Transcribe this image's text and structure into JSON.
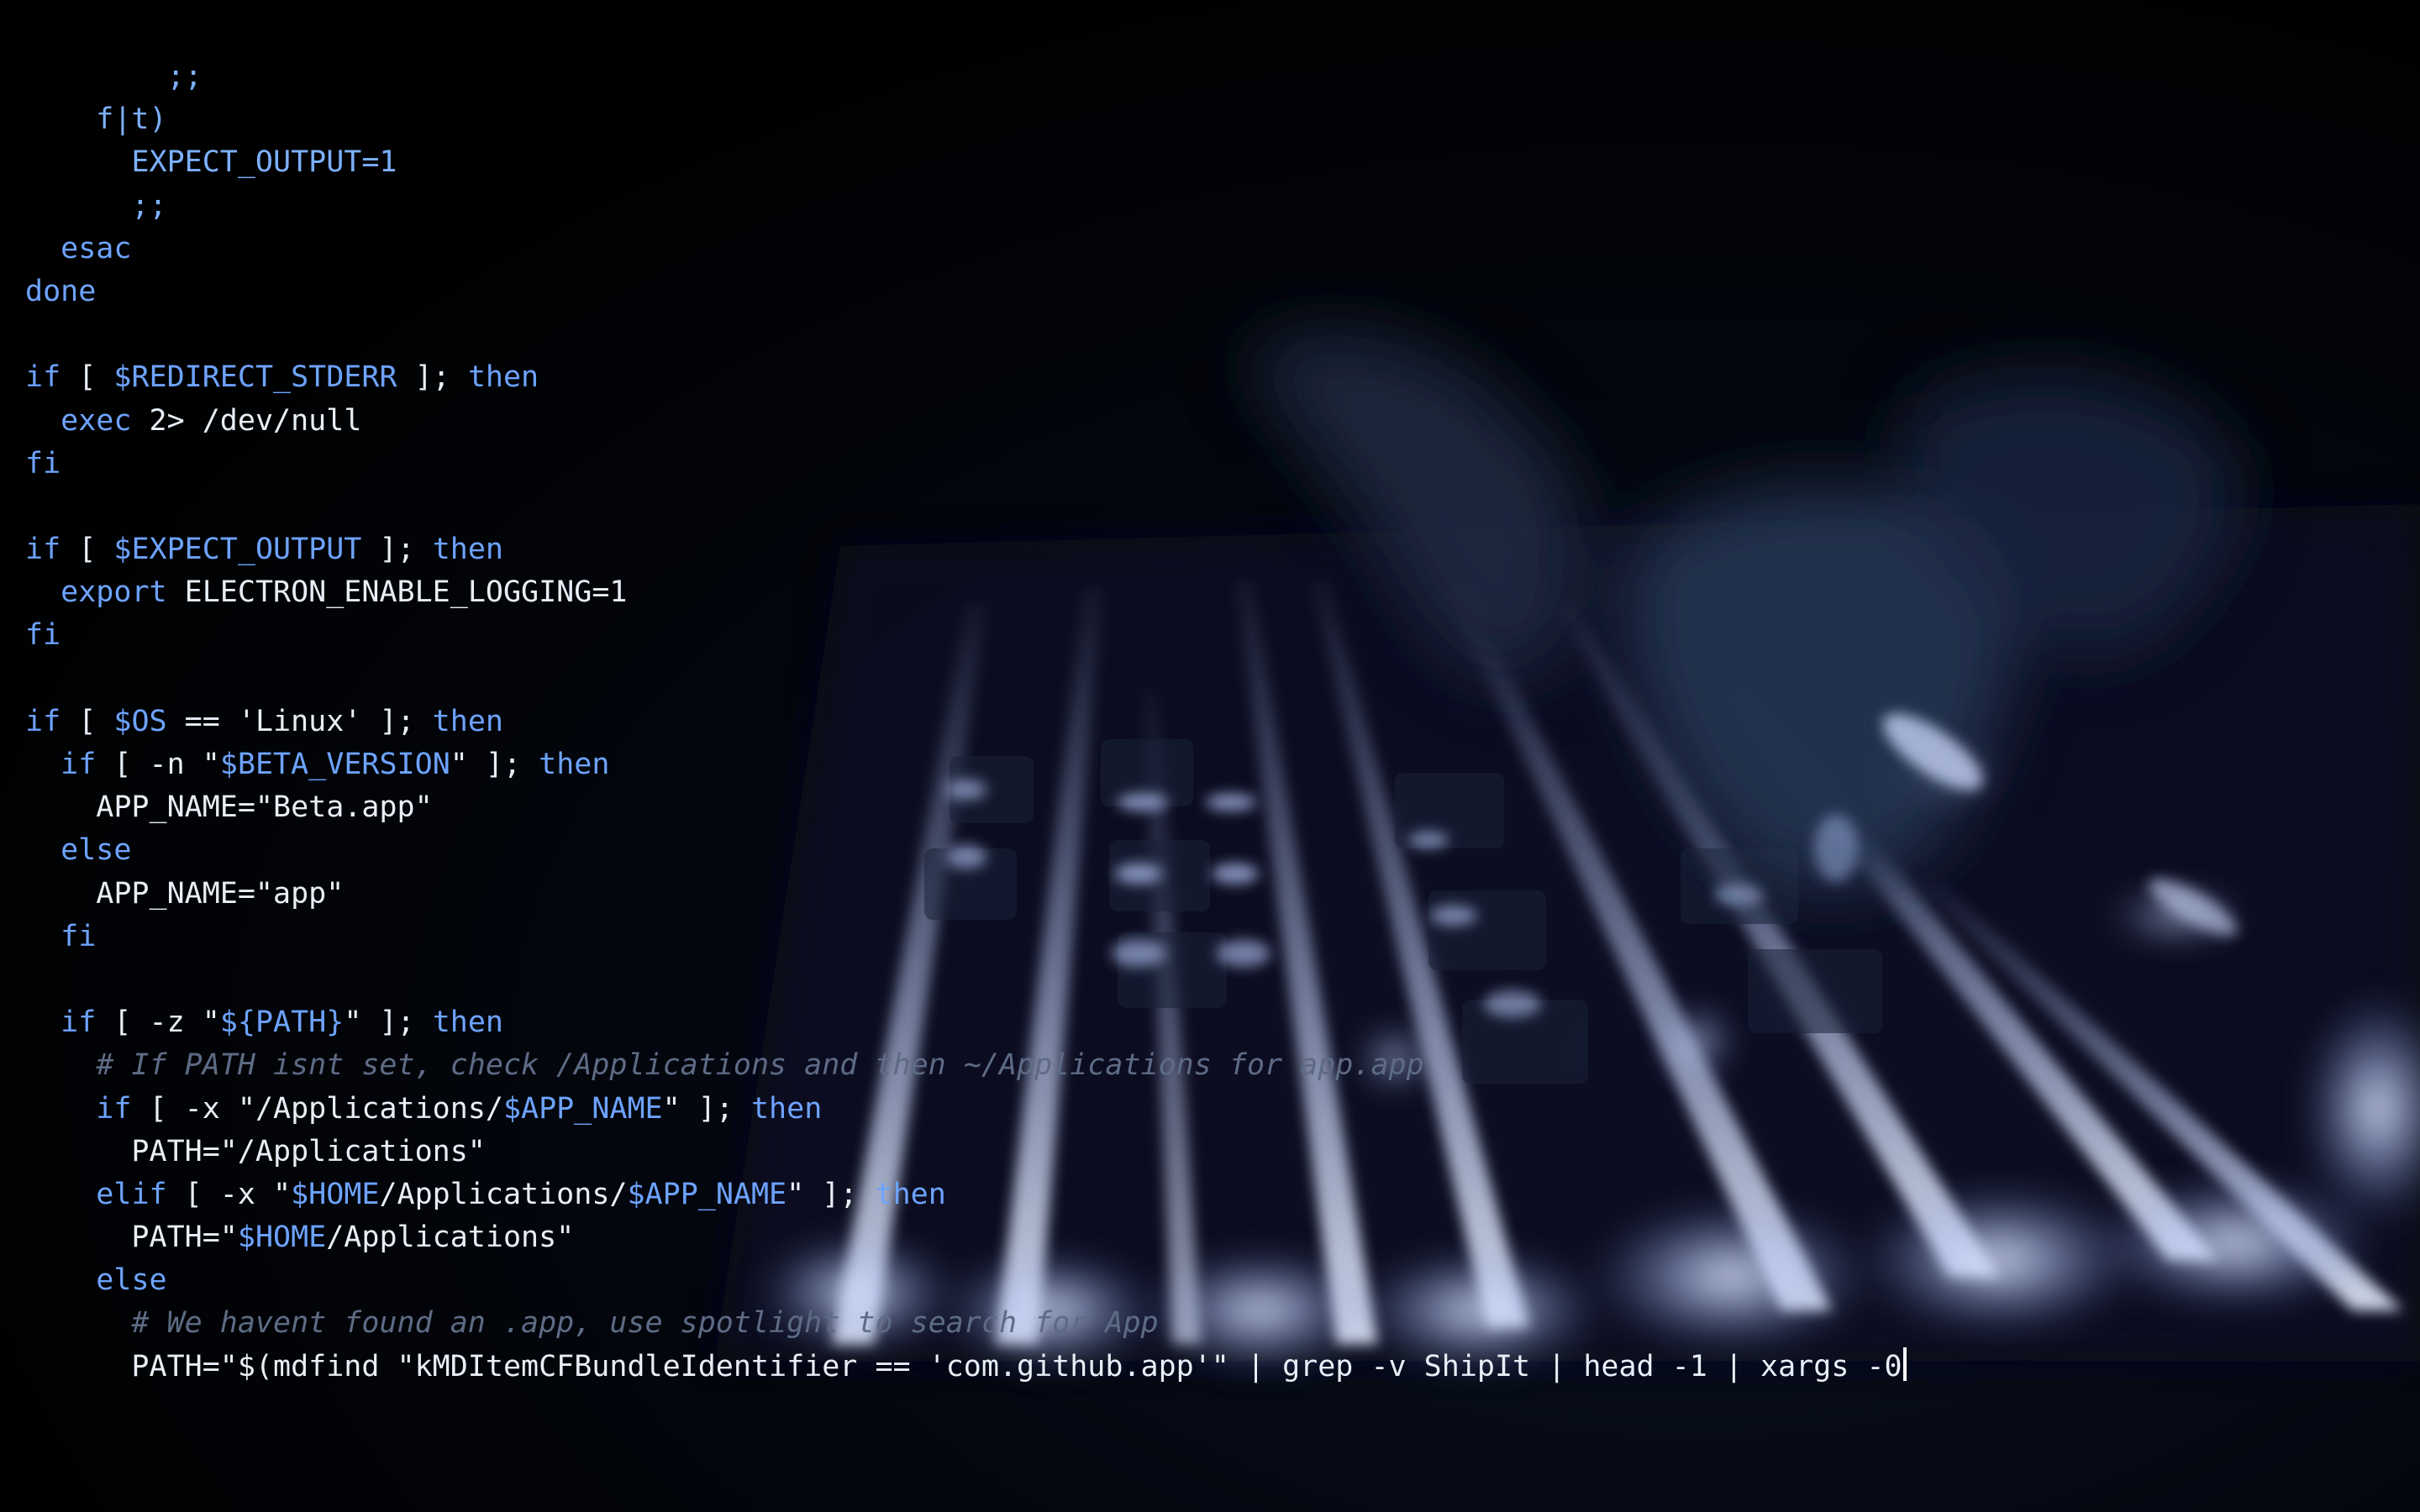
{
  "colors": {
    "background": "#000000",
    "code_text": "#e8eef6",
    "keyword": "#6da3ff",
    "variable": "#6da3ff",
    "comment": "#5d6b85",
    "key_glow": "#c9d8ff"
  },
  "scene": {
    "backdrop": "backlit-keyboard-with-typing-hands"
  },
  "code_lines": [
    [
      {
        "c": "blue",
        "t": "        ;;"
      }
    ],
    [
      {
        "c": "blue",
        "t": "    f|t)"
      }
    ],
    [
      {
        "c": "blue",
        "t": "      EXPECT_OUTPUT=1"
      }
    ],
    [
      {
        "c": "blue",
        "t": "      ;;"
      }
    ],
    [
      {
        "c": "kw",
        "t": "  esac"
      }
    ],
    [
      {
        "c": "kw",
        "t": "done"
      }
    ],
    [
      {
        "c": "plain",
        "t": ""
      }
    ],
    [
      {
        "c": "kw",
        "t": "if"
      },
      {
        "c": "plain",
        "t": " [ "
      },
      {
        "c": "var",
        "t": "$REDIRECT_STDERR"
      },
      {
        "c": "plain",
        "t": " ]; "
      },
      {
        "c": "kw",
        "t": "then"
      }
    ],
    [
      {
        "c": "plain",
        "t": "  "
      },
      {
        "c": "kw",
        "t": "exec"
      },
      {
        "c": "plain",
        "t": " 2> /dev/null"
      }
    ],
    [
      {
        "c": "kw",
        "t": "fi"
      }
    ],
    [
      {
        "c": "plain",
        "t": ""
      }
    ],
    [
      {
        "c": "kw",
        "t": "if"
      },
      {
        "c": "plain",
        "t": " [ "
      },
      {
        "c": "var",
        "t": "$EXPECT_OUTPUT"
      },
      {
        "c": "plain",
        "t": " ]; "
      },
      {
        "c": "kw",
        "t": "then"
      }
    ],
    [
      {
        "c": "plain",
        "t": "  "
      },
      {
        "c": "kw",
        "t": "export"
      },
      {
        "c": "plain",
        "t": " ELECTRON_ENABLE_LOGGING=1"
      }
    ],
    [
      {
        "c": "kw",
        "t": "fi"
      }
    ],
    [
      {
        "c": "plain",
        "t": ""
      }
    ],
    [
      {
        "c": "kw",
        "t": "if"
      },
      {
        "c": "plain",
        "t": " [ "
      },
      {
        "c": "var",
        "t": "$OS"
      },
      {
        "c": "plain",
        "t": " == 'Linux' ]; "
      },
      {
        "c": "kw",
        "t": "then"
      }
    ],
    [
      {
        "c": "plain",
        "t": "  "
      },
      {
        "c": "kw",
        "t": "if"
      },
      {
        "c": "plain",
        "t": " [ -n \""
      },
      {
        "c": "var",
        "t": "$BETA_VERSION"
      },
      {
        "c": "plain",
        "t": "\" ]; "
      },
      {
        "c": "kw",
        "t": "then"
      }
    ],
    [
      {
        "c": "plain",
        "t": "    APP_NAME=\"Beta.app\""
      }
    ],
    [
      {
        "c": "plain",
        "t": "  "
      },
      {
        "c": "kw",
        "t": "else"
      }
    ],
    [
      {
        "c": "plain",
        "t": "    APP_NAME=\"app\""
      }
    ],
    [
      {
        "c": "plain",
        "t": "  "
      },
      {
        "c": "kw",
        "t": "fi"
      }
    ],
    [
      {
        "c": "plain",
        "t": ""
      }
    ],
    [
      {
        "c": "plain",
        "t": "  "
      },
      {
        "c": "kw",
        "t": "if"
      },
      {
        "c": "plain",
        "t": " [ -z \""
      },
      {
        "c": "var",
        "t": "${PATH}"
      },
      {
        "c": "plain",
        "t": "\" ]; "
      },
      {
        "c": "kw",
        "t": "then"
      }
    ],
    [
      {
        "c": "cm",
        "t": "    # If PATH isnt set, check /Applications and then ~/Applications for app.app"
      }
    ],
    [
      {
        "c": "plain",
        "t": "    "
      },
      {
        "c": "kw",
        "t": "if"
      },
      {
        "c": "plain",
        "t": " [ -x \"/Applications/"
      },
      {
        "c": "var",
        "t": "$APP_NAME"
      },
      {
        "c": "plain",
        "t": "\" ]; "
      },
      {
        "c": "kw",
        "t": "then"
      }
    ],
    [
      {
        "c": "plain",
        "t": "      PATH=\"/Applications\""
      }
    ],
    [
      {
        "c": "plain",
        "t": "    "
      },
      {
        "c": "kw",
        "t": "elif"
      },
      {
        "c": "plain",
        "t": " [ -x \""
      },
      {
        "c": "var",
        "t": "$HOME"
      },
      {
        "c": "plain",
        "t": "/Applications/"
      },
      {
        "c": "var",
        "t": "$APP_NAME"
      },
      {
        "c": "plain",
        "t": "\" ]; "
      },
      {
        "c": "kw",
        "t": "then"
      }
    ],
    [
      {
        "c": "plain",
        "t": "      PATH=\""
      },
      {
        "c": "var",
        "t": "$HOME"
      },
      {
        "c": "plain",
        "t": "/Applications\""
      }
    ],
    [
      {
        "c": "plain",
        "t": "    "
      },
      {
        "c": "kw",
        "t": "else"
      }
    ],
    [
      {
        "c": "cm",
        "t": "      # We havent found an .app, use spotlight to search for App"
      }
    ],
    [
      {
        "c": "plain",
        "t": "      PATH=\"$(mdfind \"kMDItemCFBundleIdentifier == 'com.github.app'\" | grep -v ShipIt | head -1 | xargs -0"
      }
    ]
  ]
}
